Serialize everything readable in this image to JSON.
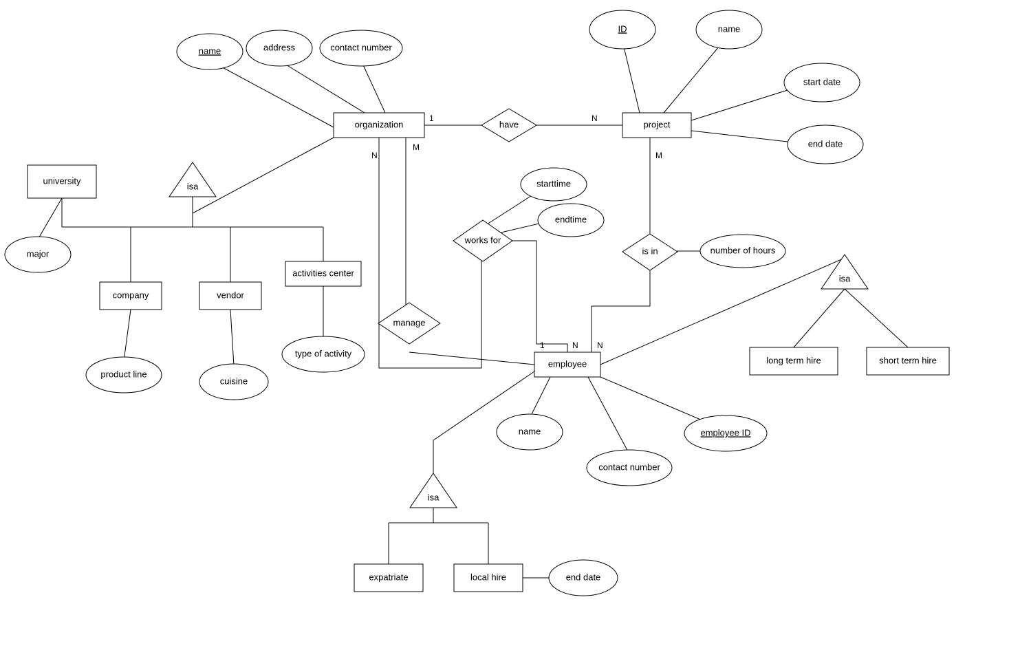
{
  "entities": {
    "organization": "organization",
    "project": "project",
    "university": "university",
    "company": "company",
    "vendor": "vendor",
    "activities_center": "activities center",
    "employee": "employee",
    "expatriate": "expatriate",
    "local_hire": "local hire",
    "long_term_hire": "long term hire",
    "short_term_hire": "short term hire"
  },
  "relationships": {
    "have": "have",
    "isa_org": "isa",
    "works_for": "works for",
    "manage": "manage",
    "is_in": "is in",
    "isa_emp": "isa",
    "isa_hire": "isa"
  },
  "attributes": {
    "org_name": "name",
    "org_address": "address",
    "org_contact": "contact number",
    "proj_id": "ID",
    "proj_name": "name",
    "proj_start": "start date",
    "proj_end": "end date",
    "univ_major": "major",
    "comp_product": "product line",
    "vendor_cuisine": "cuisine",
    "activity_type": "type of activity",
    "wf_start": "starttime",
    "wf_end": "endtime",
    "isin_hours": "number of hours",
    "emp_name": "name",
    "emp_contact": "contact number",
    "emp_id": "employee ID",
    "local_end": "end date"
  },
  "cardinality": {
    "org_have": "1",
    "proj_have": "N",
    "org_works": "M",
    "org_manage": "N",
    "emp_manage": "1",
    "emp_works": "N",
    "emp_isin": "N",
    "proj_isin": "M"
  }
}
